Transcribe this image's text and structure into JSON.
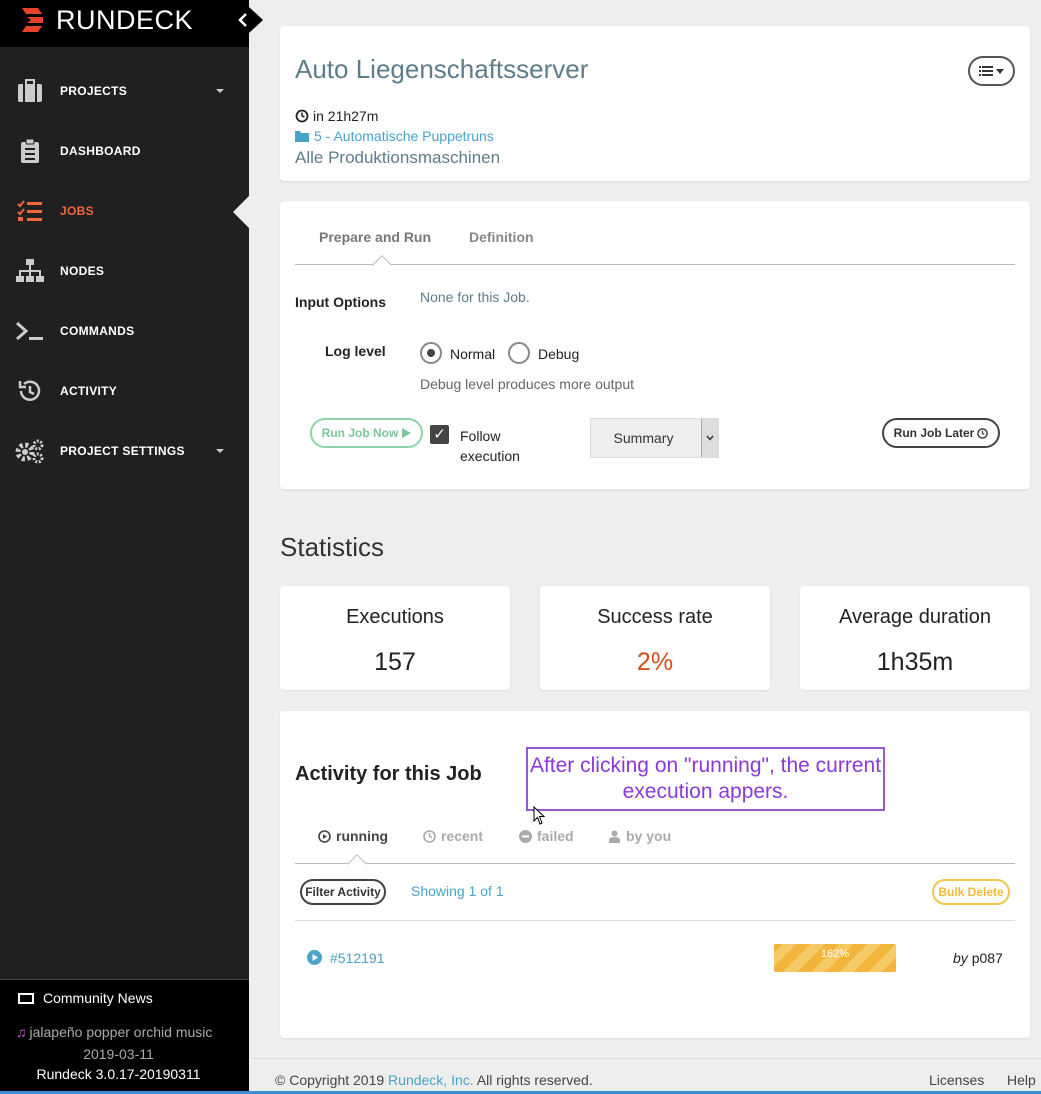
{
  "app": {
    "name": "RUNDECK"
  },
  "sidebar": {
    "items": [
      {
        "label": "PROJECTS",
        "icon": "briefcase-icon",
        "caret": true
      },
      {
        "label": "DASHBOARD",
        "icon": "clipboard-icon",
        "caret": false
      },
      {
        "label": "JOBS",
        "icon": "tasks-icon",
        "caret": false,
        "active": true
      },
      {
        "label": "NODES",
        "icon": "sitemap-icon",
        "caret": false
      },
      {
        "label": "COMMANDS",
        "icon": "terminal-icon",
        "caret": false
      },
      {
        "label": "ACTIVITY",
        "icon": "history-icon",
        "caret": false
      },
      {
        "label": "PROJECT SETTINGS",
        "icon": "gears-icon",
        "caret": true
      }
    ],
    "footer": {
      "news": "Community News",
      "version_name": "jalapeño popper orchid music",
      "version_date": "2019-03-11",
      "version": "Rundeck 3.0.17-20190311"
    }
  },
  "job": {
    "title": "Auto Liegenschaftsserver",
    "schedule": "in 21h27m",
    "group": "5 - Automatische Puppetruns",
    "description": "Alle Produktionsmaschinen"
  },
  "run": {
    "tabs": [
      "Prepare and Run",
      "Definition"
    ],
    "input_options_label": "Input Options",
    "input_options_value": "None for this Job.",
    "log_level_label": "Log level",
    "log_levels": [
      "Normal",
      "Debug"
    ],
    "log_level_selected": "Normal",
    "debug_hint": "Debug level produces more output",
    "run_now": "Run Job Now",
    "follow_label": "Follow execution",
    "follow_checked": true,
    "output_mode": "Summary",
    "run_later": "Run Job Later"
  },
  "statistics": {
    "title": "Statistics",
    "cards": [
      {
        "label": "Executions",
        "value": "157"
      },
      {
        "label": "Success rate",
        "value": "2%"
      },
      {
        "label": "Average duration",
        "value": "1h35m"
      }
    ]
  },
  "activity": {
    "title": "Activity for this Job",
    "annotation": "After clicking on \"running\", the current execution appers.",
    "tabs": [
      "running",
      "recent",
      "failed",
      "by you"
    ],
    "active_tab": "running",
    "filter": "Filter Activity",
    "showing": "Showing 1 of 1",
    "bulk_delete": "Bulk Delete",
    "executions": [
      {
        "id": "#512191",
        "progress_label": "162%",
        "progress_fraction": 1.0,
        "by_prefix": "by",
        "user": "p087"
      }
    ]
  },
  "footer": {
    "copyright_pre": "© Copyright 2019 ",
    "company": "Rundeck, Inc.",
    "copyright_post": " All rights reserved.",
    "licenses": "Licenses",
    "help": "Help"
  },
  "colors": {
    "accent": "#f0693a",
    "link": "#4aa3c8",
    "success": "#7ac79a",
    "warning": "#f0b53a",
    "danger": "#d44d1d",
    "annotation": "#8d38d8"
  }
}
